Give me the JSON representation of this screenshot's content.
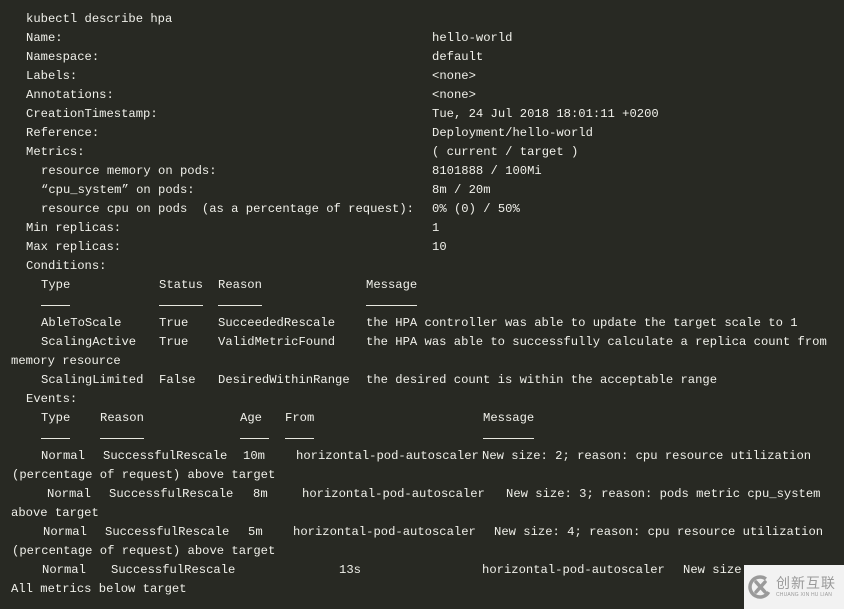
{
  "command": "kubectl describe hpa",
  "fields": {
    "name_label": "Name:",
    "name_value": "hello-world",
    "namespace_label": "Namespace:",
    "namespace_value": "default",
    "labels_label": "Labels:",
    "labels_value": "<none>",
    "annotations_label": "Annotations:",
    "annotations_value": "<none>",
    "creation_label": "CreationTimestamp:",
    "creation_value": "Tue, 24 Jul 2018 18:01:11 +0200",
    "reference_label": "Reference:",
    "reference_value": "Deployment/hello-world",
    "metrics_label": "Metrics:",
    "metrics_value": "( current / target )",
    "min_replicas_label": "Min replicas:",
    "min_replicas_value": "1",
    "max_replicas_label": "Max replicas:",
    "max_replicas_value": "10"
  },
  "metrics": [
    {
      "label": "resource memory on pods:",
      "value": "8101888 / 100Mi"
    },
    {
      "label": "“cpu_system” on pods:",
      "value": "8m / 20m"
    },
    {
      "label": "resource cpu on pods  (as a percentage of request):",
      "value": "0% (0) / 50%"
    }
  ],
  "conditions": {
    "title": "Conditions:",
    "headers": {
      "type": "Type",
      "status": "Status",
      "reason": "Reason",
      "message": "Message"
    },
    "rows": [
      {
        "type": "AbleToScale",
        "status": "True",
        "reason": "SucceededRescale",
        "message": "the HPA controller was able to update the target scale to 1"
      },
      {
        "type": "ScalingActive",
        "status": "True",
        "reason": "ValidMetricFound",
        "message": "the HPA was able to successfully calculate a replica count from",
        "wrap": "memory resource"
      },
      {
        "type": "ScalingLimited",
        "status": "False",
        "reason": "DesiredWithinRange",
        "message": "the desired count is within the acceptable range"
      }
    ]
  },
  "events": {
    "title": "Events:",
    "headers": {
      "type": "Type",
      "reason": "Reason",
      "age": "Age",
      "from": "From",
      "message": "Message"
    },
    "rows": [
      {
        "type": "Normal",
        "reason": "SuccessfulRescale",
        "age": "10m",
        "from": "horizontal-pod-autoscaler",
        "message": "New size: 2; reason: cpu resource utilization",
        "wrap": "(percentage of request) above target"
      },
      {
        "type": "Normal",
        "reason": "SuccessfulRescale",
        "age": "8m",
        "from": "horizontal-pod-autoscaler",
        "message": "New size: 3; reason: pods metric cpu_system",
        "wrap": "above target"
      },
      {
        "type": "Normal",
        "reason": "SuccessfulRescale",
        "age": "5m",
        "from": "horizontal-pod-autoscaler",
        "message": "New size: 4; reason: cpu resource utilization",
        "wrap": "(percentage of request) above target"
      },
      {
        "type": "Normal",
        "reason": "SuccessfulRescale",
        "age": "13s",
        "from": "horizontal-pod-autoscaler",
        "message": "New size",
        "wrap": "All metrics below target"
      }
    ]
  },
  "watermark": {
    "cn": "创新互联",
    "en": "CHUANG XIN HU LIAN",
    "color": "#9a9a9a"
  }
}
